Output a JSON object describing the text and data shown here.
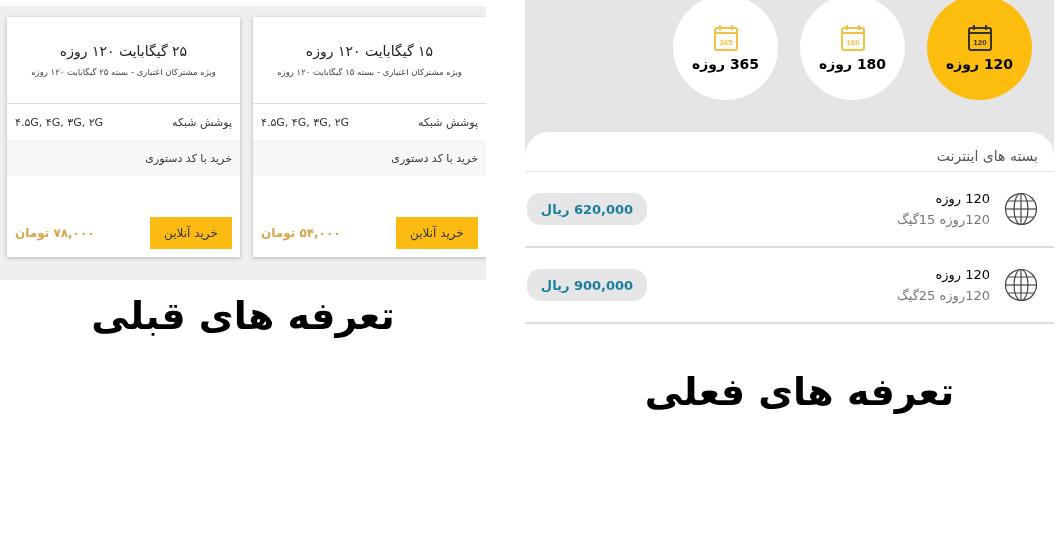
{
  "old_plans": {
    "cards": [
      {
        "title": "۱۵ گیگابایت ۱۲۰ روزه",
        "subtitle": "ویژه مشترکان اعتباری - بسته ۱۵ گیگابایت ۱۲۰ روزه",
        "coverage_label": "پوشش شبکه",
        "coverage_value": "۴.۵G, ۴G, ۳G, ۲G",
        "ussd_label": "خرید با کد دستوری",
        "buy_button": "خرید آنلاین",
        "price": "۵۴,۰۰۰ تومان"
      },
      {
        "title": "۲۵ گیگابایت ۱۲۰ روزه",
        "subtitle": "ویژه مشترکان اعتباری - بسته ۲۵ گیگابایت ۱۲۰ روزه",
        "coverage_label": "پوشش شبکه",
        "coverage_value": "۴.۵G, ۴G, ۳G, ۲G",
        "ussd_label": "خرید با کد دستوری",
        "buy_button": "خرید آنلاین",
        "price": "۷۸,۰۰۰ تومان"
      }
    ],
    "caption": "تعرفه های قبلی"
  },
  "current_plans": {
    "tabs": [
      {
        "icon_label": "120",
        "label": "120 روزه",
        "selected": true
      },
      {
        "icon_label": "180",
        "label": "180 روزه",
        "selected": false
      },
      {
        "icon_label": "365",
        "label": "365 روزه",
        "selected": false
      }
    ],
    "section_title": "بسته های اینترنت",
    "rows": [
      {
        "title": "120 روزه",
        "subtitle": "120روزه 15گیگ",
        "price": "620,000 ریال"
      },
      {
        "title": "120 روزه",
        "subtitle": "120روزه 25گیگ",
        "price": "900,000 ریال"
      }
    ],
    "caption": "تعرفه های فعلی"
  }
}
